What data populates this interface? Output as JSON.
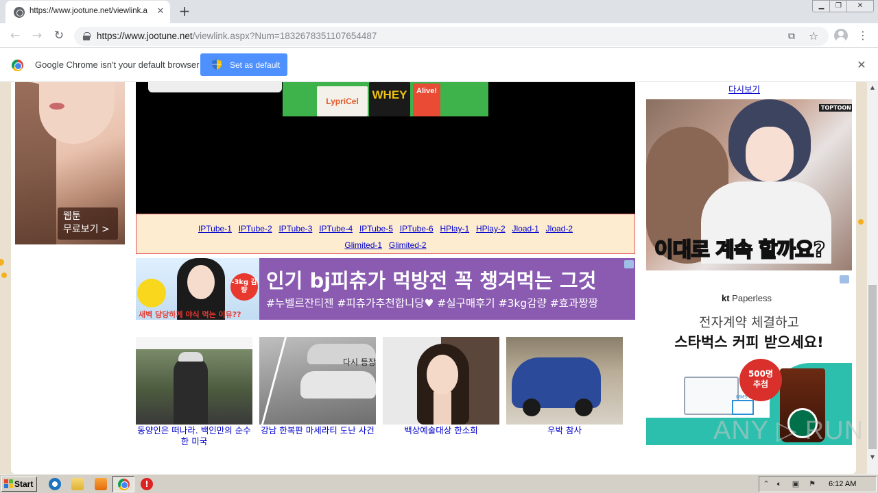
{
  "browser": {
    "tab_title": "https://www.jootune.net/viewlink.a",
    "url_host": "https://www.jootune.net",
    "url_path": "/viewlink.aspx?Num=1832678351107654487",
    "new_tab": "+",
    "tab_close": "✕"
  },
  "infobar": {
    "message": "Google Chrome isn't your default browser",
    "button": "Set as default",
    "close": "✕"
  },
  "left_ad": {
    "line1": "웹툰",
    "line2": "무료보기 >"
  },
  "supplement_ad": {
    "brand1": "LypriCel",
    "brand2": "WHEY",
    "brand3": "Alive!"
  },
  "links": {
    "row1": [
      "IPTube-1",
      "IPTube-2",
      "IPTube-3",
      "IPTube-4",
      "IPTube-5",
      "IPTube-6",
      "HPlay-1",
      "HPlay-2",
      "Jload-1",
      "Jload-2"
    ],
    "row2": [
      "Glimited-1",
      "Glimited-2"
    ]
  },
  "banner": {
    "title": "인기 bj피츄가 먹방전 꼭 챙겨먹는 그것",
    "tags": "#누벨르잔티젠 #피츄가추천합니당♥ #실구매후기 #3kg감량 #효과짱짱",
    "caption": "새벽 당당하게 야식 먹는 이유??",
    "badge": "-3kg 감량"
  },
  "thumbnails": [
    {
      "caption": "동양인은 떠나라. 백인만의 순수한 미국"
    },
    {
      "caption": "강남 한복판 마세라티 도난 사건",
      "overlay": "다시 등장"
    },
    {
      "caption": "백상예술대상 한소희"
    },
    {
      "caption": "우박 참사"
    }
  ],
  "right_ads": {
    "top_link": "다시보기",
    "toptoon_logo": "TOPTOON",
    "manga_text_a": "이대로 ",
    "manga_text_b": "계속",
    "manga_text_c": " 할까요?",
    "kt_brand": "kt",
    "kt_product": " Paperless",
    "kt_line1": "전자계약 체결하고",
    "kt_line2": "스타벅스 커피 받으세요!",
    "kt_badge1": "500명",
    "kt_badge2": "추첨",
    "kt_mail": "MMS"
  },
  "watermark": "ANY ▷ RUN",
  "taskbar": {
    "start": "Start",
    "clock": "6:12 AM"
  },
  "colors": {
    "link": "#0000cc",
    "infobar_button": "#4d90fe",
    "banner_bg": "#8b5bb2",
    "link_box_bg": "#fdecd0",
    "link_box_border": "#e05858"
  }
}
